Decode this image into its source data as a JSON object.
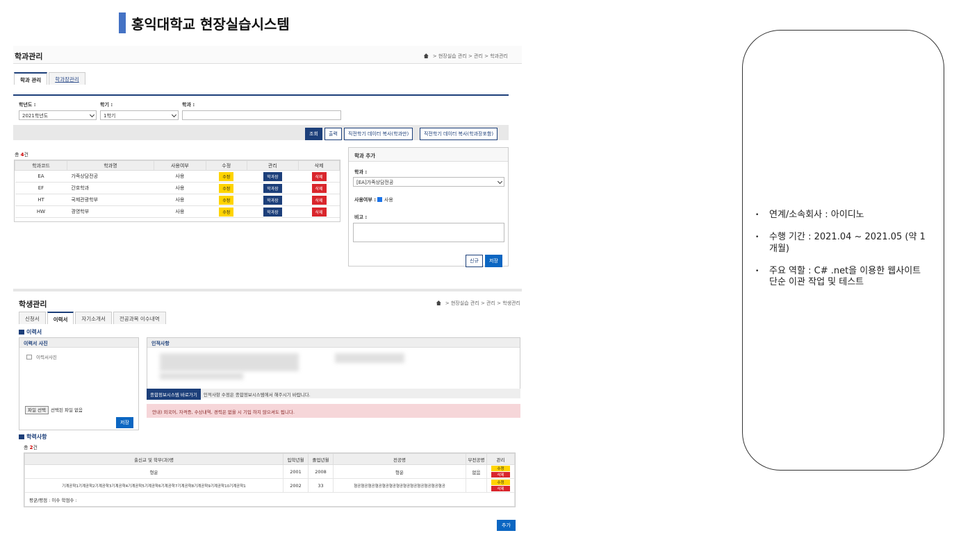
{
  "slide": {
    "title": "홍익대학교 현장실습시스템"
  },
  "screen1": {
    "page_title": "학과관리",
    "breadcrumb": "> 현장실습 관리 > 관리 > 학과관리",
    "tabs": [
      "학과 관리",
      "학과장관리"
    ],
    "search": {
      "year_label": "학년도 :",
      "year_value": "2021학년도",
      "term_label": "학기 :",
      "term_value": "1학기",
      "dept_label": "학과 :"
    },
    "buttons": {
      "search": "조회",
      "print": "출력",
      "copy1": "직전학기 데이터 복사(학과만)",
      "copy2": "직전학기 데이터 복사(학과장포함)"
    },
    "count_prefix": "총 ",
    "count_value": "4",
    "count_suffix": "건",
    "columns": [
      "학과코드",
      "학과명",
      "사용여부",
      "수정",
      "관리",
      "삭제"
    ],
    "rows": [
      {
        "code": "EA",
        "name": "가족상담전공",
        "use": "사용"
      },
      {
        "code": "EF",
        "name": "간호학과",
        "use": "사용"
      },
      {
        "code": "HT",
        "name": "국제관광학부",
        "use": "사용"
      },
      {
        "code": "HW",
        "name": "경영학부",
        "use": "사용"
      }
    ],
    "row_btn": {
      "edit": "수정",
      "manage": "학과장",
      "del": "삭제"
    },
    "add_panel": {
      "title": "학과 추가",
      "dept_label": "학과 :",
      "dept_value": "[EA]가족상담전공",
      "use_label": "사용여부 :",
      "use_value": "사용",
      "note_label": "비고 :",
      "new_btn": "신규",
      "save_btn": "저장"
    }
  },
  "screen2": {
    "page_title": "학생관리",
    "breadcrumb": "> 현장실습 관리 > 관리 > 학생관리",
    "tabs": [
      "신청서",
      "이력서",
      "자기소개서",
      "전공과목 이수내역"
    ],
    "section_resume": "이력서",
    "photo_panel": "이력서 사진",
    "photo_alt": "이력서사진",
    "file_btn": "파일 선택",
    "file_status": "선택된 파일 없음",
    "photo_save": "저장",
    "personal_panel": "인적사항",
    "link_btn": "종합정보시스템 바로가기",
    "link_text": "인적사항 수정은 종합정보시스템에서 해주시기 바랍니다.",
    "notice": "안내) 외국어, 자격증, 수상내역, 경력은 없을 시 기입 하지 않으셔도 됩니다.",
    "section_edu": "학력사항",
    "count_prefix": "총 ",
    "count_value": "2",
    "count_suffix": "건",
    "hist_columns": [
      "출신교 및 학부(과)명",
      "입학년월",
      "졸업년월",
      "전공명",
      "부전공명",
      "관리"
    ],
    "hist_rows": [
      {
        "school": "형운",
        "in": "2001",
        "out": "2008",
        "major": "형운",
        "minor": "없음"
      },
      {
        "school": "기계공학1기계공학2기계공학3기계공학4기계공학5기계공학6기계공학7기계공학8기계공학9기계공학10기계공학1",
        "in": "2002",
        "out": "33",
        "major": "형공형공형공형공형공형공형공형공형공형공형공형공형공",
        "minor": ""
      }
    ],
    "hist_btn": {
      "edit": "수정",
      "del": "삭제"
    },
    "gpa_line": "평균/평점 : 이수 학점수 :",
    "add_btn": "추가"
  },
  "info": {
    "items": [
      "연계/소속회사 : 아이디노",
      "수행 기간 : 2021.04 ~ 2021.05 (약 1개월)",
      "주요 역할 :  C# .net을 이용한 웹사이트 단순 이관 작업 및 테스트"
    ]
  }
}
